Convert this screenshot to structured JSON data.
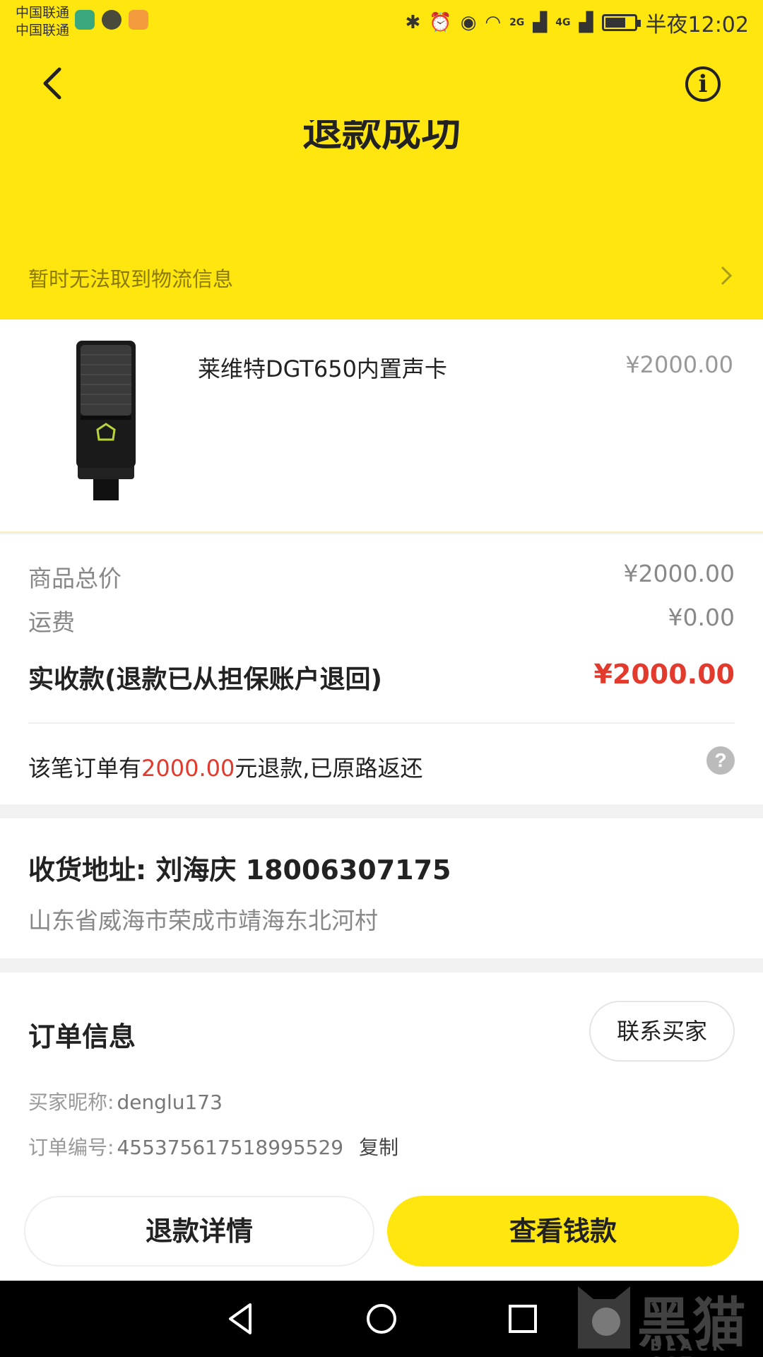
{
  "statusbar": {
    "carrier1": "中国联通",
    "carrier2": "中国联通",
    "net1": "2G",
    "net2": "4G",
    "time": "半夜12:02"
  },
  "header": {
    "status_title": "退款成功",
    "logistics_text": "暂时无法取到物流信息"
  },
  "product": {
    "name": "莱维特DGT650内置声卡",
    "price": "¥2000.00"
  },
  "price": {
    "goods_total_label": "商品总价",
    "goods_total_value": "¥2000.00",
    "shipping_label": "运费",
    "shipping_value": "¥0.00",
    "received_label": "实收款(退款已从担保账户退回)",
    "received_value": "¥2000.00",
    "refund_note_prefix": "该笔订单有",
    "refund_note_amount": "2000.00",
    "refund_note_suffix": "元退款,已原路返还"
  },
  "address": {
    "title": "收货地址:  刘海庆   18006307175",
    "detail": "山东省威海市荣成市靖海东北河村"
  },
  "order": {
    "title": "订单信息",
    "contact_button": "联系买家",
    "buyer_label": "买家昵称:",
    "buyer_value": "denglu173",
    "order_no_label": "订单编号:",
    "order_no_value": "455375617518995529",
    "copy_label": "复制"
  },
  "actions": {
    "refund_detail": "退款详情",
    "view_money": "查看钱款"
  },
  "watermark": {
    "text": "黑猫",
    "sub": "BLACK CAT"
  },
  "colors": {
    "brand_yellow": "#ffe60f",
    "price_red": "#e33a2e"
  }
}
